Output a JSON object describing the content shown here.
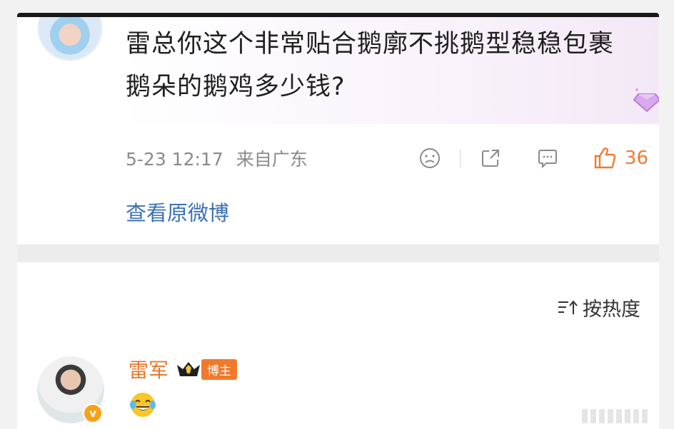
{
  "comment": {
    "text": "雷总你这个非常贴合鹅廓不挑鹅型稳稳包裹鹅朵的鹅鸡多少钱?",
    "timestamp": "5-23 12:17",
    "location": "来自广东",
    "like_count": "36"
  },
  "view_original_label": "查看原微博",
  "sort": {
    "label": "按热度",
    "icon": "sort-icon"
  },
  "reply": {
    "username": "雷军",
    "owner_badge": "博主"
  },
  "colors": {
    "link_blue": "#3b6fb5",
    "accent_orange": "#ef7a32",
    "username_orange": "#e8772e"
  }
}
